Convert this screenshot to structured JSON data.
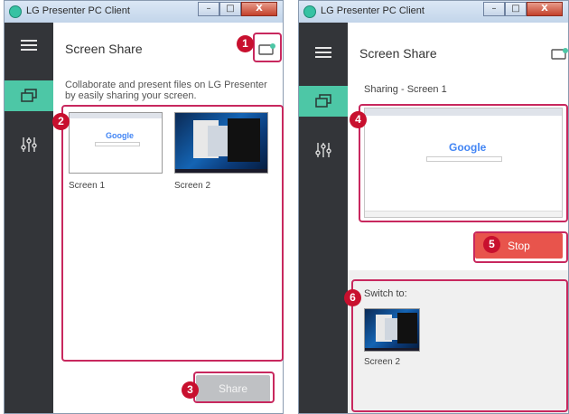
{
  "windows": {
    "left": {
      "title": "LG Presenter PC Client",
      "page_title": "Screen Share",
      "description": "Collaborate and present files on LG Presenter by easily sharing your screen.",
      "screens": [
        {
          "label": "Screen 1"
        },
        {
          "label": "Screen 2"
        }
      ],
      "share_label": "Share"
    },
    "right": {
      "title": "LG Presenter PC Client",
      "page_title": "Screen Share",
      "sharing_label": "Sharing - Screen 1",
      "stop_label": "Stop",
      "switch_to_label": "Switch to:",
      "switch_screens": [
        {
          "label": "Screen 2"
        }
      ]
    }
  },
  "title_buttons": {
    "minimize": "–",
    "maximize": "□",
    "close": "X"
  },
  "google_logo": "Google",
  "callouts": [
    "1",
    "2",
    "3",
    "4",
    "5",
    "6"
  ],
  "icons": {
    "menu": "hamburger-menu-icon",
    "screen_share": "screen-share-icon",
    "settings": "sliders-icon",
    "cast": "cast-icon"
  },
  "colors": {
    "sidebar": "#333539",
    "active_nav": "#4dc7a6",
    "highlight": "#c8285e",
    "callout": "#c8102e",
    "stop_button": "#e8544c",
    "disabled_button": "#bfc1c4"
  }
}
